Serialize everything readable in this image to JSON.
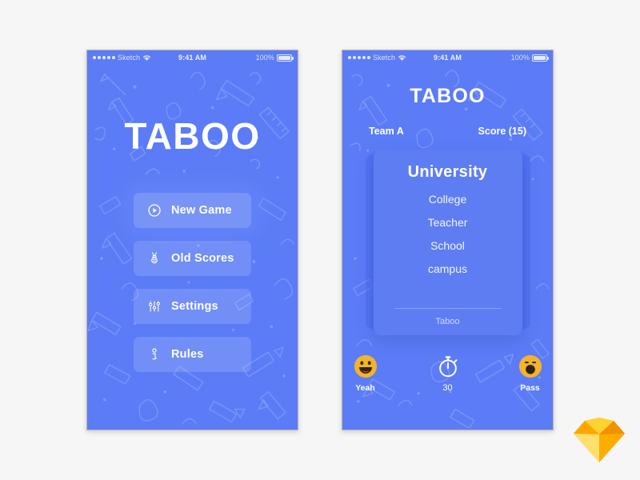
{
  "page": {
    "background_color": "#f6f6f6",
    "brand_blue": "#5b7cf6",
    "accent_yellow": "#f6b93b",
    "logo": "sketch-diamond-logo"
  },
  "status_bar": {
    "signal_dots": 5,
    "carrier": "Sketch",
    "wifi_icon": "wifi-icon",
    "time": "9:41 AM",
    "battery_percent": "100%",
    "battery_icon": "battery-full-icon"
  },
  "home_screen": {
    "title": "TABOO",
    "menu": [
      {
        "label": "New Game",
        "icon": "play-circle-icon",
        "primary": true
      },
      {
        "label": "Old Scores",
        "icon": "medal-icon",
        "primary": false
      },
      {
        "label": "Settings",
        "icon": "sliders-icon",
        "primary": false
      },
      {
        "label": "Rules",
        "icon": "info-person-icon",
        "primary": false
      }
    ]
  },
  "game_screen": {
    "title": "TABOO",
    "team_label": "Team A",
    "score_label": "Score (15)",
    "card": {
      "word": "University",
      "taboo_words": [
        "College",
        "Teacher",
        "School",
        "campus"
      ],
      "footer_label": "Taboo"
    },
    "actions": [
      {
        "label": "Yeah",
        "icon": "smiley-happy-icon"
      },
      {
        "label": "30",
        "icon": "stopwatch-icon"
      },
      {
        "label": "Pass",
        "icon": "smiley-surprised-icon"
      }
    ]
  }
}
